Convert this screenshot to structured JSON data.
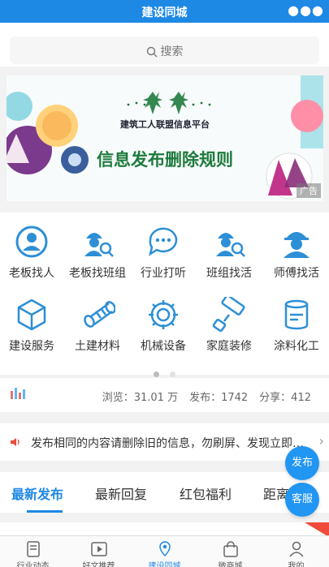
{
  "header": {
    "title": "建设同城",
    "more_icon": "●●●"
  },
  "search": {
    "placeholder": "搜索"
  },
  "banner": {
    "subtitle": "建筑工人联盟信息平台",
    "headline": "信息发布删除规则",
    "ad_label": "广告"
  },
  "categories": [
    {
      "label": "老板找人",
      "icon": "person-search-icon"
    },
    {
      "label": "老板找班组",
      "icon": "worker-search-icon"
    },
    {
      "label": "行业打听",
      "icon": "chat-bubble-icon"
    },
    {
      "label": "班组找活",
      "icon": "team-search-icon"
    },
    {
      "label": "师傅找活",
      "icon": "helmet-worker-icon"
    },
    {
      "label": "建设服务",
      "icon": "cube-icon"
    },
    {
      "label": "土建材料",
      "icon": "rebar-icon"
    },
    {
      "label": "机械设备",
      "icon": "gear-icon"
    },
    {
      "label": "家庭装修",
      "icon": "paint-roller-icon"
    },
    {
      "label": "涂料化工",
      "icon": "paint-bucket-icon"
    }
  ],
  "stats": {
    "views": "浏览：31.01 万",
    "posts": "发布：1742",
    "shares": "分享：412"
  },
  "notice": {
    "text": "发布相同的内容请删除旧的信息，勿刷屏、发现立即删除"
  },
  "tabs": [
    "最新发布",
    "最新回复",
    "红包福利",
    "距离最近"
  ],
  "float_buttons": {
    "publish": "发布",
    "service": "客服"
  },
  "bottom_nav": [
    {
      "label": "行业动态",
      "icon": "news-icon"
    },
    {
      "label": "好文推荐",
      "icon": "video-icon"
    },
    {
      "label": "建设同城",
      "icon": "location-icon",
      "active": true
    },
    {
      "label": "微商城",
      "icon": "shopping-bag-icon"
    },
    {
      "label": "我的",
      "icon": "user-icon"
    }
  ],
  "colors": {
    "brand": "#1e88e5",
    "icon_blue": "#2d8fd6",
    "banner_green": "#1e7a3c"
  }
}
